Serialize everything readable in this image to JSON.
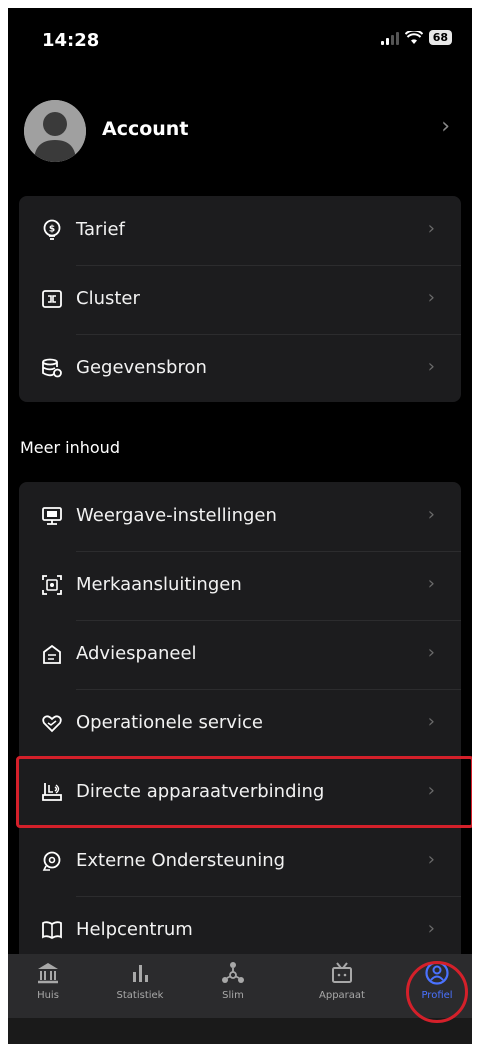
{
  "status_bar": {
    "time": "14:28",
    "battery": "68"
  },
  "account": {
    "label": "Account"
  },
  "card1": {
    "items": [
      {
        "label": "Tarief",
        "icon": "lightbulb-dollar-icon"
      },
      {
        "label": "Cluster",
        "icon": "cluster-icon"
      },
      {
        "label": "Gegevensbron",
        "icon": "database-icon"
      }
    ]
  },
  "section": {
    "label": "Meer inhoud"
  },
  "card2": {
    "items": [
      {
        "label": "Weergave-instellingen",
        "icon": "monitor-icon"
      },
      {
        "label": "Merkaansluitingen",
        "icon": "brand-link-icon"
      },
      {
        "label": "Adviespaneel",
        "icon": "advice-panel-icon"
      },
      {
        "label": "Operationele service",
        "icon": "heart-hands-icon"
      },
      {
        "label": "Directe apparaatverbinding",
        "icon": "device-connect-icon"
      },
      {
        "label": "Externe Ondersteuning",
        "icon": "support-icon"
      },
      {
        "label": "Helpcentrum",
        "icon": "book-icon"
      }
    ]
  },
  "tabbar": {
    "tabs": [
      {
        "label": "Huis",
        "icon": "home-icon"
      },
      {
        "label": "Statistiek",
        "icon": "bar-chart-icon"
      },
      {
        "label": "Slim",
        "icon": "nodes-icon"
      },
      {
        "label": "Apparaat",
        "icon": "device-icon"
      },
      {
        "label": "Profiel",
        "icon": "profile-icon"
      }
    ],
    "active": "Profiel"
  },
  "colors": {
    "accent": "#4a72ff",
    "highlight": "#d4202a",
    "card": "#1c1c1e",
    "background": "#000000"
  }
}
